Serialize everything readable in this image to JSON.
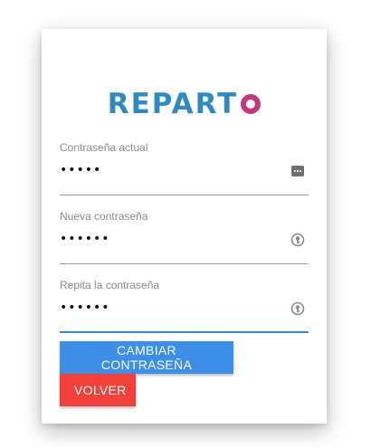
{
  "logo": {
    "text": "REPART",
    "accent_letter": "O",
    "colors": {
      "main": "#2f8bbf",
      "accent": "#c7357f"
    }
  },
  "form": {
    "current_password": {
      "label": "Contraseña actual",
      "value": "•••••",
      "icon": "password-dots-icon"
    },
    "new_password": {
      "label": "Nueva contraseña",
      "value": "••••••",
      "icon": "key-icon"
    },
    "repeat_password": {
      "label": "Repita la contraseña",
      "value": "••••••",
      "icon": "key-icon"
    }
  },
  "buttons": {
    "change_password": "CAMBIAR CONTRASEÑA",
    "back": "VOLVER"
  },
  "colors": {
    "primary": "#3d8ee6",
    "danger": "#f2413b",
    "focus_underline": "#2f8be0"
  }
}
